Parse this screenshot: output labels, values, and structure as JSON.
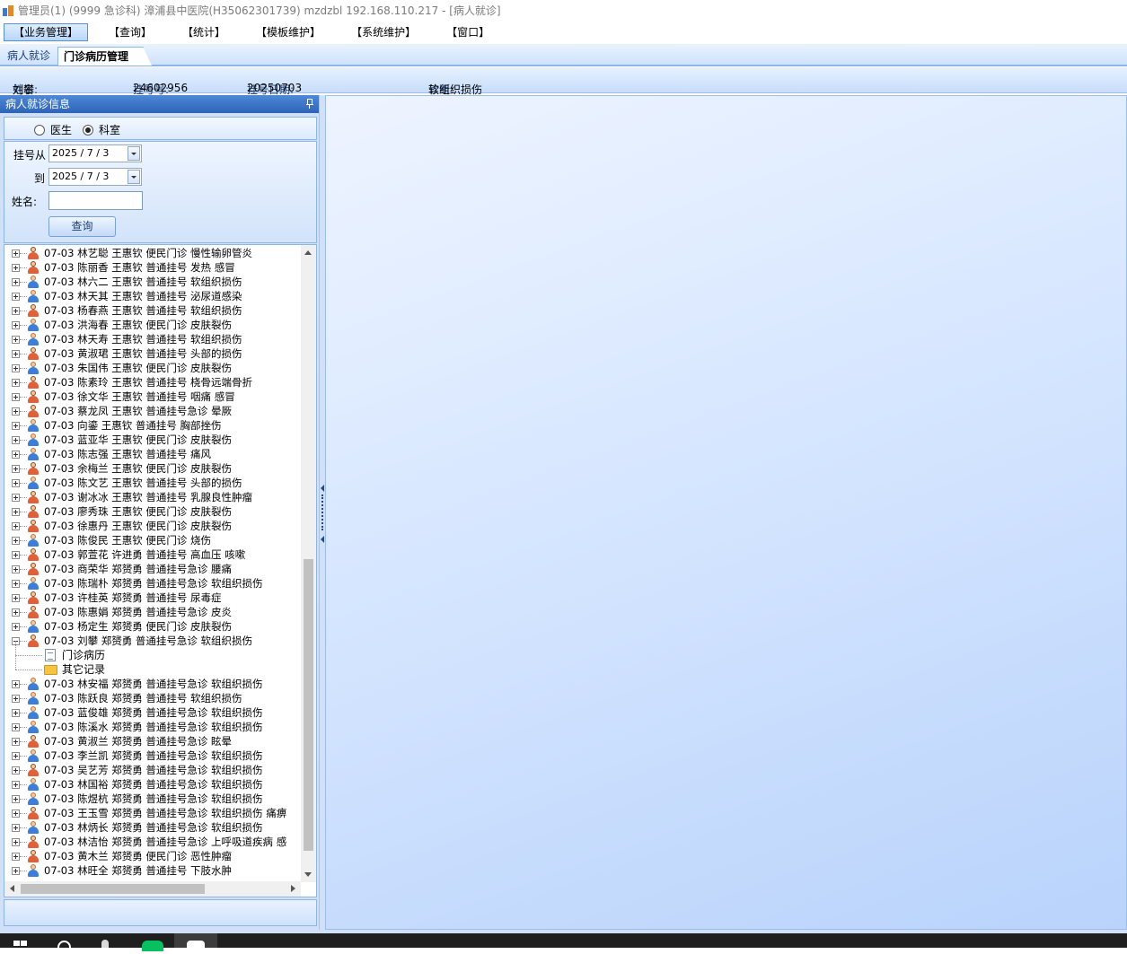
{
  "window": {
    "title": "管理员(1) (9999 急诊科) 漳浦县中医院(H35062301739) mzdzbl 192.168.110.217 - [病人就诊]"
  },
  "menu": [
    {
      "label": "【业务管理】",
      "active": true
    },
    {
      "label": "【查询】"
    },
    {
      "label": "【统计】"
    },
    {
      "label": "【模板维护】"
    },
    {
      "label": "【系统维护】"
    },
    {
      "label": "【窗口】"
    }
  ],
  "tabs": {
    "patient_visit": "病人就诊",
    "outpatient_record": "门诊病历管理"
  },
  "patient_info": {
    "name_label": "姓名:",
    "name": "刘攀",
    "reg_no_label": "挂号号:",
    "reg_no": "24602956",
    "reg_date_label": "挂号日期:",
    "reg_date": "20250703",
    "diagnosis_label": "诊断:",
    "diagnosis": "软组织损伤"
  },
  "panel": {
    "title": "病人就诊信息",
    "radio_doctor": "医生",
    "radio_dept": "科室",
    "selected_radio": "科室",
    "reg_from_label": "挂号从",
    "reg_from_value": "2025 / 7 / 3",
    "reg_to_label": "到",
    "reg_to_value": "2025 / 7 / 3",
    "name_label": "姓名:",
    "name_value": "",
    "query_button": "查询"
  },
  "tree": {
    "rows_before": [
      {
        "text": "07-03  林艺聪  王惠钦  便民门诊  慢性输卵管炎",
        "gender": "female"
      },
      {
        "text": "07-03  陈丽香  王惠钦  普通挂号  发热 感冒",
        "gender": "female"
      },
      {
        "text": "07-03  林六二  王惠钦  普通挂号  软组织损伤",
        "gender": "male"
      },
      {
        "text": "07-03  林天其  王惠钦  普通挂号  泌尿道感染",
        "gender": "male"
      },
      {
        "text": "07-03  杨春燕  王惠钦  普通挂号  软组织损伤",
        "gender": "female"
      },
      {
        "text": "07-03  洪海春  王惠钦  便民门诊  皮肤裂伤",
        "gender": "male"
      },
      {
        "text": "07-03  林天寿  王惠钦  普通挂号  软组织损伤",
        "gender": "male"
      },
      {
        "text": "07-03  黄淑珺  王惠钦  普通挂号  头部的损伤",
        "gender": "female"
      },
      {
        "text": "07-03  朱国伟  王惠钦  便民门诊  皮肤裂伤",
        "gender": "male"
      },
      {
        "text": "07-03  陈素玲  王惠钦  普通挂号  桡骨远端骨折",
        "gender": "female"
      },
      {
        "text": "07-03  徐文华  王惠钦  普通挂号  咽痛 感冒",
        "gender": "female"
      },
      {
        "text": "07-03  蔡龙凤  王惠钦  普通挂号急诊  晕厥",
        "gender": "female"
      },
      {
        "text": "07-03  向鎏  王惠钦  普通挂号  胸部挫伤",
        "gender": "male"
      },
      {
        "text": "07-03  蓝亚华  王惠钦  便民门诊  皮肤裂伤",
        "gender": "male"
      },
      {
        "text": "07-03  陈志强  王惠钦  普通挂号  痛风",
        "gender": "male"
      },
      {
        "text": "07-03  余梅兰  王惠钦  便民门诊  皮肤裂伤",
        "gender": "female"
      },
      {
        "text": "07-03  陈文艺  王惠钦  普通挂号  头部的损伤",
        "gender": "male"
      },
      {
        "text": "07-03  谢冰冰  王惠钦  普通挂号  乳腺良性肿瘤",
        "gender": "female"
      },
      {
        "text": "07-03  廖秀珠  王惠钦  便民门诊  皮肤裂伤",
        "gender": "female"
      },
      {
        "text": "07-03  徐惠丹  王惠钦  便民门诊  皮肤裂伤",
        "gender": "female"
      },
      {
        "text": "07-03  陈俊民  王惠钦  便民门诊  烧伤",
        "gender": "male"
      },
      {
        "text": "07-03  郭萱花  许进勇  普通挂号  高血压  咳嗽",
        "gender": "female"
      },
      {
        "text": "07-03  商荣华  郑赟勇  普通挂号急诊  腰痛",
        "gender": "female"
      },
      {
        "text": "07-03  陈瑞朴  郑赟勇  普通挂号急诊  软组织损伤",
        "gender": "male"
      },
      {
        "text": "07-03  许桂英  郑赟勇  普通挂号  尿毒症",
        "gender": "female"
      },
      {
        "text": "07-03  陈惠娟  郑赟勇  普通挂号急诊  皮炎",
        "gender": "female"
      },
      {
        "text": "07-03  杨定生  郑赟勇  便民门诊  皮肤裂伤",
        "gender": "male"
      }
    ],
    "expanded_row": {
      "text": "07-03  刘攀  郑赟勇  普通挂号急诊  软组织损伤",
      "gender": "female"
    },
    "children": [
      "门诊病历",
      "其它记录"
    ],
    "rows_after": [
      {
        "text": "07-03  林安福  郑赟勇  普通挂号急诊  软组织损伤",
        "gender": "male"
      },
      {
        "text": "07-03  陈跃良  郑赟勇  普通挂号  软组织损伤",
        "gender": "male"
      },
      {
        "text": "07-03  蓝俊雄  郑赟勇  普通挂号急诊  软组织损伤",
        "gender": "male"
      },
      {
        "text": "07-03  陈溪水  郑赟勇  普通挂号急诊  软组织损伤",
        "gender": "male"
      },
      {
        "text": "07-03  黄淑兰  郑赟勇  普通挂号急诊  眩晕",
        "gender": "female"
      },
      {
        "text": "07-03  李兰凯  郑赟勇  普通挂号急诊  软组织损伤",
        "gender": "male"
      },
      {
        "text": "07-03  吴艺芳  郑赟勇  普通挂号急诊  软组织损伤",
        "gender": "female"
      },
      {
        "text": "07-03  林国裕  郑赟勇  普通挂号急诊  软组织损伤",
        "gender": "male"
      },
      {
        "text": "07-03  陈煜杭  郑赟勇  普通挂号急诊  软组织损伤",
        "gender": "male"
      },
      {
        "text": "07-03  王玉雪  郑赟勇  普通挂号急诊  软组织损伤  痛痹",
        "gender": "female"
      },
      {
        "text": "07-03  林炳长  郑赟勇  普通挂号急诊  软组织损伤",
        "gender": "male"
      },
      {
        "text": "07-03  林洁怡  郑赟勇  普通挂号急诊  上呼吸道疾病  感",
        "gender": "female"
      },
      {
        "text": "07-03  黄木兰  郑赟勇  便民门诊  恶性肿瘤",
        "gender": "female"
      },
      {
        "text": "07-03  林旺全  郑赟勇  普通挂号  下肢水肿",
        "gender": "male"
      }
    ]
  }
}
